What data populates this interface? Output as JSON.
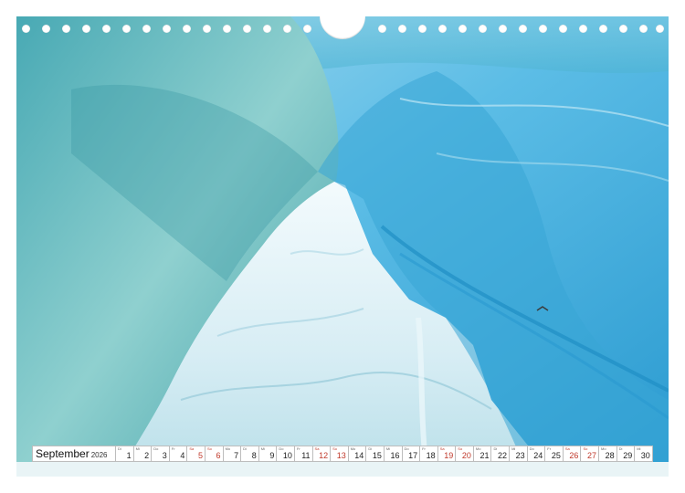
{
  "calendar": {
    "month": "September",
    "year": "2026",
    "days": [
      {
        "num": "1",
        "wd": "Di",
        "weekend": false
      },
      {
        "num": "2",
        "wd": "Mi",
        "weekend": false
      },
      {
        "num": "3",
        "wd": "Do",
        "weekend": false
      },
      {
        "num": "4",
        "wd": "Fr",
        "weekend": false
      },
      {
        "num": "5",
        "wd": "Sa",
        "weekend": true
      },
      {
        "num": "6",
        "wd": "So",
        "weekend": true
      },
      {
        "num": "7",
        "wd": "Mo",
        "weekend": false
      },
      {
        "num": "8",
        "wd": "Di",
        "weekend": false
      },
      {
        "num": "9",
        "wd": "Mi",
        "weekend": false
      },
      {
        "num": "10",
        "wd": "Do",
        "weekend": false
      },
      {
        "num": "11",
        "wd": "Fr",
        "weekend": false
      },
      {
        "num": "12",
        "wd": "Sa",
        "weekend": true
      },
      {
        "num": "13",
        "wd": "So",
        "weekend": true
      },
      {
        "num": "14",
        "wd": "Mo",
        "weekend": false
      },
      {
        "num": "15",
        "wd": "Di",
        "weekend": false
      },
      {
        "num": "16",
        "wd": "Mi",
        "weekend": false
      },
      {
        "num": "17",
        "wd": "Do",
        "weekend": false
      },
      {
        "num": "18",
        "wd": "Fr",
        "weekend": false
      },
      {
        "num": "19",
        "wd": "Sa",
        "weekend": true
      },
      {
        "num": "20",
        "wd": "So",
        "weekend": true
      },
      {
        "num": "21",
        "wd": "Mo",
        "weekend": false
      },
      {
        "num": "22",
        "wd": "Di",
        "weekend": false
      },
      {
        "num": "23",
        "wd": "Mi",
        "weekend": false
      },
      {
        "num": "24",
        "wd": "Do",
        "weekend": false
      },
      {
        "num": "25",
        "wd": "Fr",
        "weekend": false
      },
      {
        "num": "26",
        "wd": "Sa",
        "weekend": true
      },
      {
        "num": "27",
        "wd": "So",
        "weekend": true
      },
      {
        "num": "28",
        "wd": "Mo",
        "weekend": false
      },
      {
        "num": "29",
        "wd": "Di",
        "weekend": false
      },
      {
        "num": "30",
        "wd": "Mi",
        "weekend": false
      }
    ]
  },
  "colors": {
    "weekend": "#c0392b",
    "ice_deep": "#1f8fc4",
    "ice_light": "#dff2f8",
    "ice_teal": "#5fb8bf"
  }
}
